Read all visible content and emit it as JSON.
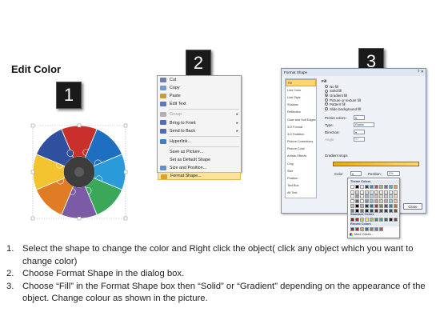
{
  "title": "Edit Color",
  "markers": [
    "1",
    "2",
    "3"
  ],
  "context_menu": {
    "items": [
      {
        "label": "Cut",
        "underline": "t",
        "icon": "scissors-icon",
        "color": "#6b7fa8",
        "disabled": false,
        "arrow": false
      },
      {
        "label": "Copy",
        "underline": "C",
        "icon": "copy-icon",
        "color": "#7d98c8",
        "disabled": false,
        "arrow": false
      },
      {
        "label": "Paste",
        "underline": "P",
        "icon": "paste-icon",
        "color": "#c79a3a",
        "disabled": false,
        "arrow": false
      },
      {
        "label": "Edit Text",
        "underline": "x",
        "icon": "edit-text-icon",
        "color": "#5a79b8",
        "disabled": false,
        "arrow": false,
        "sep_after": true
      },
      {
        "label": "Group",
        "underline": "G",
        "icon": "group-icon",
        "color": "#b0b0b0",
        "disabled": true,
        "arrow": true
      },
      {
        "label": "Bring to Front",
        "underline": "r",
        "icon": "bring-front-icon",
        "color": "#4f6fb0",
        "disabled": false,
        "arrow": true
      },
      {
        "label": "Send to Back",
        "underline": "k",
        "icon": "send-back-icon",
        "color": "#4f6fb0",
        "disabled": false,
        "arrow": true,
        "sep_after": true
      },
      {
        "label": "Hyperlink...",
        "underline": "H",
        "icon": "hyperlink-icon",
        "color": "#3f7fc0",
        "disabled": false,
        "arrow": false,
        "sep_after": true
      },
      {
        "label": "Save as Picture...",
        "underline": "S",
        "icon": "",
        "color": "",
        "disabled": false,
        "arrow": false
      },
      {
        "label": "Set as Default Shape",
        "underline": "D",
        "icon": "",
        "color": "",
        "disabled": false,
        "arrow": false
      },
      {
        "label": "Size and Position...",
        "underline": "z",
        "icon": "size-position-icon",
        "color": "#6a8cc8",
        "disabled": false,
        "arrow": false
      },
      {
        "label": "Format Shape...",
        "underline": "o",
        "icon": "format-shape-icon",
        "color": "#e0a030",
        "disabled": false,
        "arrow": false,
        "selected": true
      }
    ]
  },
  "dialog": {
    "title": "Format Shape",
    "nav": [
      "Fill",
      "Line Color",
      "Line Style",
      "Shadow",
      "Reflection",
      "Glow and Soft Edges",
      "3-D Format",
      "3-D Rotation",
      "Picture Corrections",
      "Picture Color",
      "Artistic Effects",
      "Crop",
      "Size",
      "Position",
      "Text Box",
      "Alt Text"
    ],
    "section": "Fill",
    "options": [
      "No fill",
      "Solid fill",
      "Gradient fill",
      "Picture or texture fill",
      "Pattern fill",
      "Slide background fill"
    ],
    "selected_option": "Gradient fill",
    "preset_label": "Preset colors:",
    "type_label": "Type:",
    "type_value": "Radial",
    "direction_label": "Direction:",
    "angle_label": "Angle:",
    "angle_value": "90°",
    "stops_label": "Gradient stops",
    "color_label": "Color",
    "position_label": "Position:",
    "position_value": "0%",
    "brightness_label": "Brightness:",
    "transparency_label": "Transparency:",
    "rotate_label": "Rotate with shape",
    "close_label": "Close"
  },
  "palette": {
    "theme_header": "Theme Colors",
    "standard_header": "Standard Colors",
    "recent_header": "Recent Colors",
    "more_label": "More Colors...",
    "theme_top": [
      "#ffffff",
      "#000000",
      "#eeece1",
      "#1f497d",
      "#4f81bd",
      "#c0504d",
      "#9bbb59",
      "#8064a2",
      "#4bacc6",
      "#f79646"
    ],
    "standard": [
      "#c00000",
      "#ff0000",
      "#ffc000",
      "#ffff00",
      "#92d050",
      "#00b050",
      "#00b0f0",
      "#0070c0",
      "#002060",
      "#7030a0"
    ],
    "recent": [
      "#3f3f9f",
      "#ff0000",
      "#f2a900",
      "#1f6fc0",
      "#7f7f7f",
      "#4f81bd",
      "#c0504d"
    ]
  },
  "wheel": {
    "segments": [
      "#c9302c",
      "#1f6fc0",
      "#2a9ad8",
      "#3aa858",
      "#7b5aa6",
      "#e07b26",
      "#f4c430",
      "#2f4f9f"
    ],
    "hub_color": "#444444"
  },
  "steps": [
    {
      "num": "1.",
      "text": "Select the shape to change the color and Right click the object( click any object which you want to change color)"
    },
    {
      "num": "2.",
      "text": "Choose Format Shape in the dialog box."
    },
    {
      "num": "3.",
      "text": "Choose “Fill” in the Format Shape box then “Solid” or “Gradient” depending on the appearance of the object. Change colour as shown in the picture."
    }
  ]
}
